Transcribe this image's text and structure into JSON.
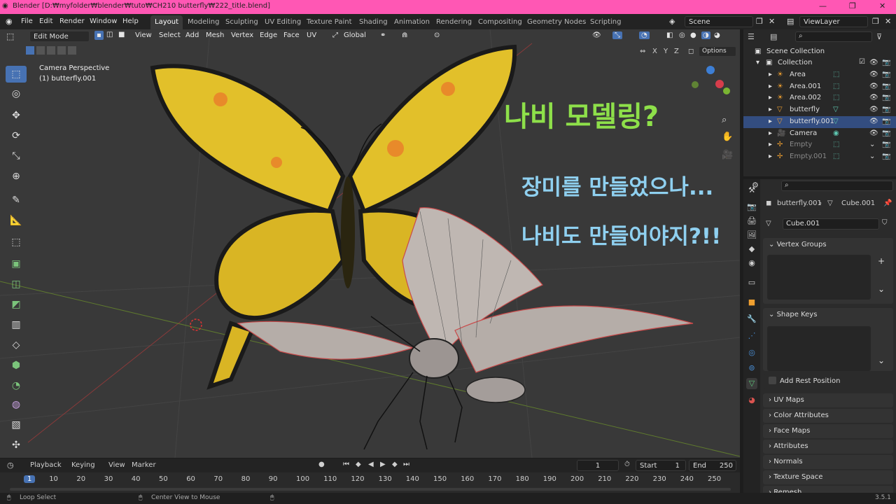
{
  "window": {
    "title": "Blender [D:₩myfolder₩blender₩tuto₩CH210 butterfly₩222_title.blend]"
  },
  "menu": [
    "File",
    "Edit",
    "Render",
    "Window",
    "Help"
  ],
  "workspaces": [
    "Layout",
    "Modeling",
    "Sculpting",
    "UV Editing",
    "Texture Paint",
    "Shading",
    "Animation",
    "Rendering",
    "Compositing",
    "Geometry Nodes",
    "Scripting"
  ],
  "scene": {
    "scene_name": "Scene",
    "view_layer": "ViewLayer"
  },
  "header": {
    "mode": "Edit Mode",
    "view": "View",
    "select": "Select",
    "add": "Add",
    "mesh": "Mesh",
    "vertex": "Vertex",
    "edge": "Edge",
    "face": "Face",
    "uv": "UV",
    "orientation": "Global",
    "options": "Options",
    "axes": [
      "X",
      "Y",
      "Z"
    ]
  },
  "viewport": {
    "camera": "Camera Perspective",
    "object": "(1) butterfly.001"
  },
  "overlay": {
    "line1": "나비 모델링?",
    "line2": "장미를 만들었으나...",
    "line3": "나비도 만들어야지?!!"
  },
  "colors": {
    "title_bar": "#ff57b4",
    "accent": "#4772b3",
    "overlay_green": "#8ee04a",
    "overlay_blue": "#8fd0f0"
  },
  "outliner": {
    "scene_collection": "Scene Collection",
    "collection": "Collection",
    "items": [
      {
        "name": "Area",
        "icon": "light-icon",
        "selected": false
      },
      {
        "name": "Area.001",
        "icon": "light-icon",
        "selected": false
      },
      {
        "name": "Area.002",
        "icon": "light-icon",
        "selected": false
      },
      {
        "name": "butterfly",
        "icon": "mesh-icon",
        "selected": false
      },
      {
        "name": "butterfly.001",
        "icon": "mesh-icon",
        "selected": true
      },
      {
        "name": "Camera",
        "icon": "camera-icon",
        "selected": false
      },
      {
        "name": "Empty",
        "icon": "empty-icon",
        "selected": false
      },
      {
        "name": "Empty.001",
        "icon": "empty-icon",
        "selected": false
      }
    ]
  },
  "properties": {
    "breadcrumb_object": "butterfly.001",
    "breadcrumb_mesh": "Cube.001",
    "mesh_name": "Cube.001",
    "vertex_groups": "Vertex Groups",
    "shape_keys": "Shape Keys",
    "add_rest_position": "Add Rest Position",
    "sections": [
      "UV Maps",
      "Color Attributes",
      "Face Maps",
      "Attributes",
      "Normals",
      "Texture Space",
      "Remesh"
    ]
  },
  "timeline": {
    "playback": "Playback",
    "keying": "Keying",
    "view": "View",
    "marker": "Marker",
    "current_frame": "1",
    "start_label": "Start",
    "start": "1",
    "end_label": "End",
    "end": "250",
    "frames": [
      "1",
      "10",
      "20",
      "30",
      "40",
      "50",
      "60",
      "70",
      "80",
      "90",
      "100",
      "110",
      "120",
      "130",
      "140",
      "150",
      "160",
      "170",
      "180",
      "190",
      "200",
      "210",
      "220",
      "230",
      "240",
      "250"
    ]
  },
  "status": {
    "left": "Loop Select",
    "middle": "Center View to Mouse",
    "version": "3.5.1"
  }
}
